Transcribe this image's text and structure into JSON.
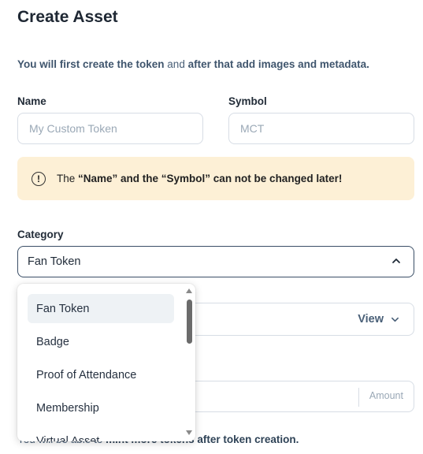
{
  "page": {
    "title": "Create Asset",
    "intro_bold_1": "You will first create the token",
    "intro_plain": " and ",
    "intro_bold_2": "after that add images and metadata."
  },
  "form": {
    "name_label": "Name",
    "name_placeholder": "My Custom Token",
    "symbol_label": "Symbol",
    "symbol_placeholder": "MCT",
    "warning_prefix": "The ",
    "warning_bold": "“Name” and the “Symbol” can not be changed later!",
    "category_label": "Category",
    "category_value": "Fan Token",
    "view_label": "View",
    "amount_placeholder": "Amount",
    "hint_plain": "You will be able to ",
    "hint_bold": "mint more tokens after token creation."
  },
  "dropdown": {
    "options": [
      "Fan Token",
      "Badge",
      "Proof of Attendance",
      "Membership",
      "Virtual Asset"
    ],
    "selected": "Fan Token"
  },
  "colors": {
    "warning_bg": "#fdf0d6",
    "selected_option_bg": "#eef2f5",
    "select_border": "#3a4e66"
  }
}
